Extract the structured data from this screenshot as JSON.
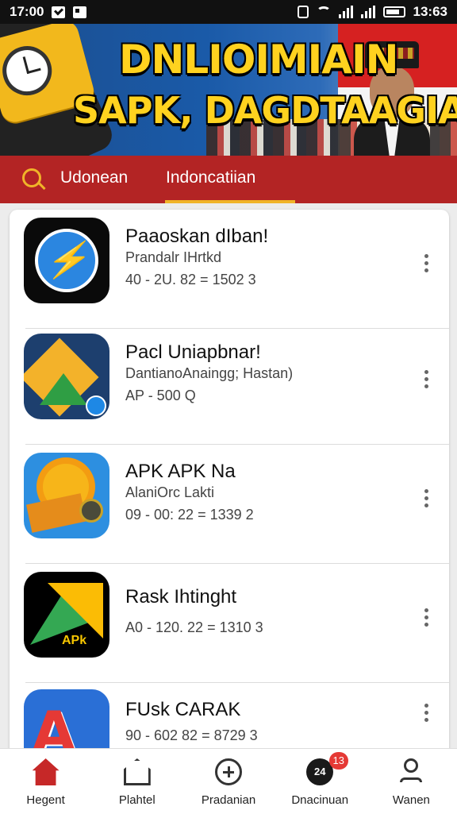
{
  "status_bar": {
    "time": "17:00",
    "right_time": "13:63",
    "icons": [
      "check-icon",
      "image-icon",
      "vibrate-icon",
      "wifi-icon",
      "signal-icon",
      "signal-icon",
      "battery-icon"
    ]
  },
  "banner": {
    "title_line1": "DNLIOIMIAIN",
    "title_line2": "SAPK, DAGDTAAGIA"
  },
  "tabs": {
    "items": [
      "Udonean",
      "Indoncatiian"
    ],
    "selected": "Indoncatiian"
  },
  "apps": [
    {
      "name": "Paaoskan dIban!",
      "subtitle": "Prandalr IHrtkd",
      "meta": "40 - 2U. 82 = 1502  3",
      "icon": "blue-circle-app-icon"
    },
    {
      "name": "Pacl Uniapbnar!",
      "subtitle": "DantianoAnaingg; Hastan)",
      "meta": "AP - 500  Q",
      "icon": "yellow-green-app-icon"
    },
    {
      "name": "APK APK Na",
      "subtitle": "AlaniOrc Lakti",
      "meta": "09 - 00: 22 = 1339  2",
      "icon": "sun-box-app-icon"
    },
    {
      "name": "Rask Ihtinght",
      "subtitle": "",
      "meta": "A0 - 120. 22 = 1310  3",
      "icon": "apk-triangle-app-icon"
    },
    {
      "name": "FUsk CARAK",
      "subtitle": "",
      "meta": "90 - 602 82 = 8729  3",
      "icon": "red-letter-app-icon"
    }
  ],
  "app_icon_labels": {
    "app4": "APk"
  },
  "bottom_nav": [
    {
      "label": "Hegent",
      "icon": "home-icon",
      "active": true
    },
    {
      "label": "Plahtel",
      "icon": "store-icon"
    },
    {
      "label": "Pradanian",
      "icon": "plus-circle-icon"
    },
    {
      "label": "Dnacinuan",
      "icon": "download-icon",
      "badge": "13",
      "icon_text": "24"
    },
    {
      "label": "Wanen",
      "icon": "user-icon"
    }
  ],
  "colors": {
    "accent": "#b32424",
    "highlight": "#f0b429",
    "title_yellow": "#ffd21f"
  }
}
